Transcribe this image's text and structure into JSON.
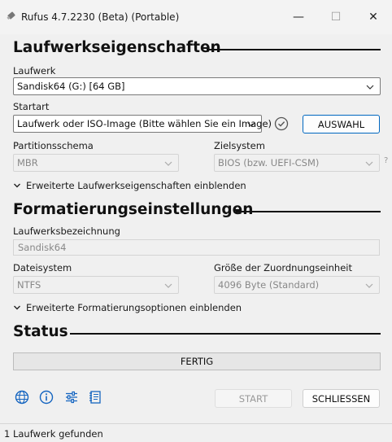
{
  "window": {
    "title": "Rufus 4.7.2230 (Beta) (Portable)",
    "minimize_glyph": "—",
    "maximize_glyph": "☐",
    "close_glyph": "✕"
  },
  "drive_properties": {
    "heading": "Laufwerkseigenschaften",
    "device_label": "Laufwerk",
    "device_value": "Sandisk64 (G:) [64 GB]",
    "boot_selection_label": "Startart",
    "boot_selection_value": "Laufwerk oder ISO-Image (Bitte wählen Sie ein Image)",
    "select_button": "AUSWAHL",
    "partition_scheme_label": "Partitionsschema",
    "partition_scheme_value": "MBR",
    "target_system_label": "Zielsystem",
    "target_system_value": "BIOS (bzw. UEFI-CSM)",
    "help_glyph": "?",
    "advanced_toggle": "Erweiterte Laufwerkseigenschaften einblenden"
  },
  "format_options": {
    "heading": "Formatierungseinstellungen",
    "volume_label_label": "Laufwerksbezeichnung",
    "volume_label_value": "Sandisk64",
    "file_system_label": "Dateisystem",
    "file_system_value": "NTFS",
    "cluster_size_label": "Größe der Zuordnungseinheit",
    "cluster_size_value": "4096 Byte (Standard)",
    "advanced_toggle": "Erweiterte Formatierungsoptionen einblenden"
  },
  "status": {
    "heading": "Status",
    "progress_text": "FERTIG",
    "progress_fraction": 0
  },
  "toolbar": {
    "icons": [
      "globe-icon",
      "info-icon",
      "settings-sliders-icon",
      "log-icon"
    ]
  },
  "actions": {
    "start_button": "START",
    "close_button": "SCHLIESSEN"
  },
  "statusbar": {
    "text": "1 Laufwerk gefunden"
  },
  "colors": {
    "accent": "#0067c0",
    "icon_blue": "#1565c0"
  }
}
